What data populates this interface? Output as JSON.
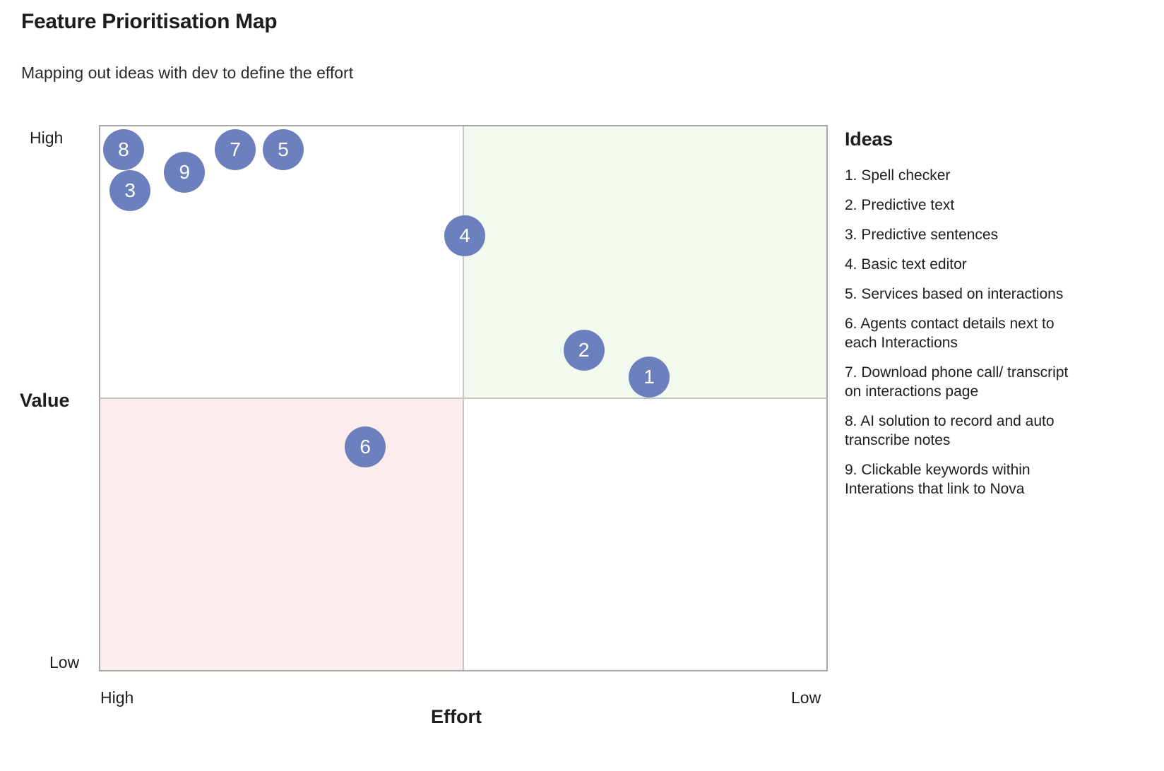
{
  "header": {
    "title": "Feature Prioritisation Map",
    "subtitle": "Mapping out ideas with dev to define the effort"
  },
  "axes": {
    "y_title": "Value",
    "y_high": "High",
    "y_low": "Low",
    "x_title": "Effort",
    "x_high": "High",
    "x_low": "Low"
  },
  "ideas_panel": {
    "heading": "Ideas",
    "items": [
      "1. Spell checker",
      "2. Predictive text",
      "3. Predictive sentences",
      "4. Basic text editor",
      "5. Services based on interactions",
      "6. Agents contact details next to each Interactions",
      "7. Download phone call/ transcript on interactions page",
      "8. AI solution to record and auto transcribe notes",
      "9. Clickable keywords within Interations that link to Nova"
    ]
  },
  "colors": {
    "bubble": "#6b80bd",
    "quadrant_high_value_low_effort": "#f2f9ee",
    "quadrant_low_value_high_effort": "#fcecec",
    "plot_border": "#a8a8a8",
    "divider": "#c6c6c6"
  },
  "chart_data": {
    "type": "scatter",
    "title": "Feature Prioritisation Map",
    "subtitle": "Mapping out ideas with dev to define the effort",
    "xlabel": "Effort",
    "ylabel": "Value",
    "xticklabels": [
      "High",
      "Low"
    ],
    "yticklabels": [
      "Low",
      "High"
    ],
    "xlim": [
      0,
      100
    ],
    "ylim": [
      0,
      100
    ],
    "x_axis_note": "x increases left-to-right from High effort to Low effort",
    "grid": false,
    "legend": "none",
    "quadrants": [
      {
        "name": "High value / Low effort",
        "position": "top-right",
        "fill": "#f2f9ee"
      },
      {
        "name": "Low value / High effort",
        "position": "bottom-left",
        "fill": "#fcecec"
      }
    ],
    "points": [
      {
        "label": "1",
        "idea": "Spell checker",
        "x_pct": 75.6,
        "y_pct": 53.9
      },
      {
        "label": "2",
        "idea": "Predictive text",
        "x_pct": 66.6,
        "y_pct": 58.8
      },
      {
        "label": "3",
        "idea": "Predictive sentences",
        "x_pct": 4.1,
        "y_pct": 88.2
      },
      {
        "label": "4",
        "idea": "Basic text editor",
        "x_pct": 50.2,
        "y_pct": 79.9
      },
      {
        "label": "5",
        "idea": "Services based on interactions",
        "x_pct": 25.2,
        "y_pct": 95.7
      },
      {
        "label": "6",
        "idea": "Agents contact details next to each Interactions",
        "x_pct": 36.5,
        "y_pct": 41.1
      },
      {
        "label": "7",
        "idea": "Download phone call/ transcript on interactions page",
        "x_pct": 18.6,
        "y_pct": 95.7
      },
      {
        "label": "8",
        "idea": "AI solution to record and auto transcribe notes",
        "x_pct": 3.2,
        "y_pct": 95.7
      },
      {
        "label": "9",
        "idea": "Clickable keywords within Interations that link to Nova",
        "x_pct": 11.6,
        "y_pct": 91.6
      }
    ]
  }
}
